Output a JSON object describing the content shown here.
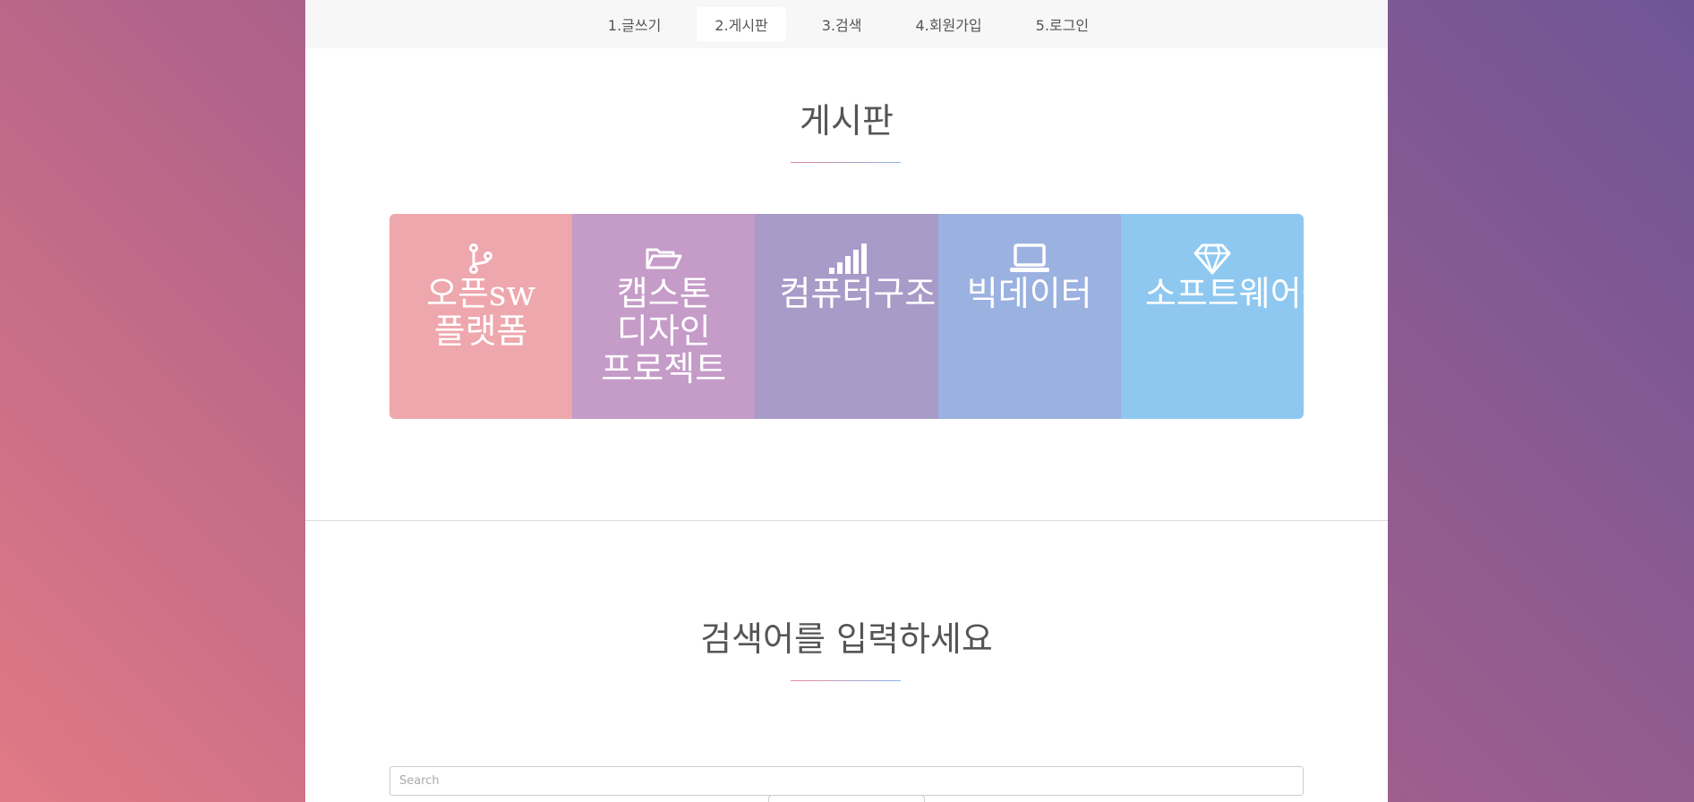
{
  "nav": {
    "items": [
      {
        "label": "1.글쓰기"
      },
      {
        "label": "2.게시판"
      },
      {
        "label": "3.검색"
      },
      {
        "label": "4.회원가입"
      },
      {
        "label": "5.로그인"
      }
    ],
    "active_index": 1
  },
  "board": {
    "title": "게시판",
    "tiles": [
      {
        "label": "오픈sw 플랫폼",
        "icon": "code-fork-icon",
        "color": "#eea7ad"
      },
      {
        "label": "캡스톤 디자인 프로젝트",
        "icon": "folder-open-icon",
        "color": "#c59bc8"
      },
      {
        "label": "컴퓨터구조",
        "icon": "signal-bars-icon",
        "color": "#a89bc8"
      },
      {
        "label": "빅데이터",
        "icon": "laptop-icon",
        "color": "#9bb1e0"
      },
      {
        "label": "소프트웨어융합창의설계",
        "icon": "diamond-icon",
        "color": "#8ec8f0"
      }
    ]
  },
  "search": {
    "title": "검색어를 입력하세요",
    "placeholder": "Search"
  },
  "colors": {
    "underline_start": "#e8899a",
    "underline_end": "#8ab4e8"
  }
}
